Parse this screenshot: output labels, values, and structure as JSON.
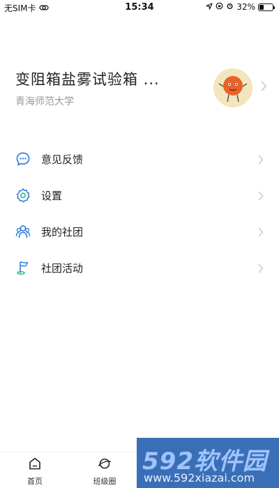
{
  "status_bar": {
    "carrier": "无SIM卡",
    "time": "15:34",
    "battery": "32%",
    "battery_level": 0.32
  },
  "profile": {
    "name": "变阻箱盐雾试验箱 ...",
    "school": "青海师范大学"
  },
  "menu": {
    "items": [
      {
        "label": "意见反馈",
        "icon": "feedback-chat-icon"
      },
      {
        "label": "设置",
        "icon": "settings-gear-icon"
      },
      {
        "label": "我的社团",
        "icon": "group-people-icon"
      },
      {
        "label": "社团活动",
        "icon": "flag-activity-icon"
      }
    ]
  },
  "tab_bar": {
    "tabs": [
      {
        "label": "首页",
        "icon": "home-icon"
      },
      {
        "label": "班级圈",
        "icon": "planet-icon"
      }
    ]
  },
  "watermark": {
    "url": "www.592xiazai.com"
  },
  "colors": {
    "accent": "#2f7fe0",
    "accent_green": "#2bbd7e",
    "avatar_bg": "#f3e6bd",
    "avatar_orange": "#e8622a",
    "muted_text": "#999999",
    "chevron": "#c8c8c8"
  }
}
